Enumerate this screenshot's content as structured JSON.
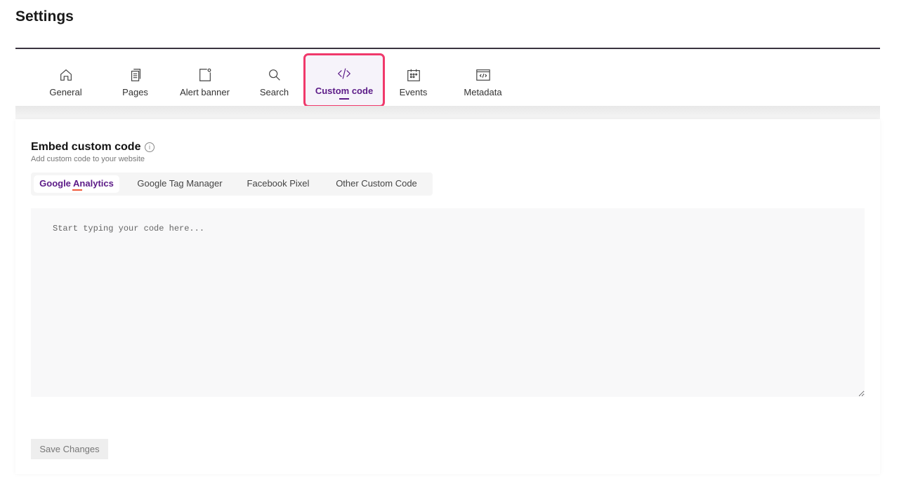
{
  "page_title": "Settings",
  "tabs": [
    {
      "label": "General",
      "icon": "home-icon"
    },
    {
      "label": "Pages",
      "icon": "pages-icon"
    },
    {
      "label": "Alert banner",
      "icon": "alert-banner-icon"
    },
    {
      "label": "Search",
      "icon": "search-icon"
    },
    {
      "label": "Custom code",
      "icon": "code-icon",
      "active": true
    },
    {
      "label": "Events",
      "icon": "calendar-icon"
    },
    {
      "label": "Metadata",
      "icon": "metadata-icon"
    }
  ],
  "section": {
    "title": "Embed custom code",
    "subtitle": "Add custom code to your website",
    "info": "i"
  },
  "subtabs": [
    "Google Analytics",
    "Google Tag Manager",
    "Facebook Pixel",
    "Other Custom Code"
  ],
  "editor": {
    "placeholder": "Start typing your code here...",
    "value": ""
  },
  "save_label": "Save Changes",
  "colors": {
    "accent": "#5b1a87",
    "highlight": "#f0396b"
  }
}
